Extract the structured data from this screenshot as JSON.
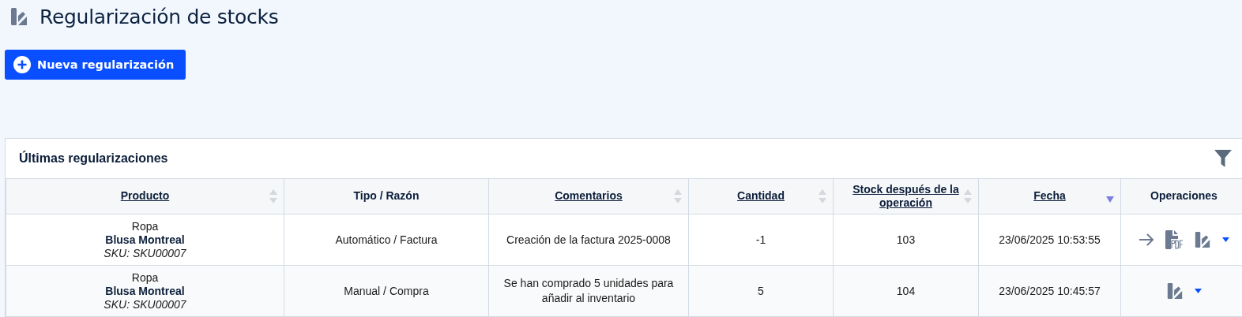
{
  "page": {
    "title": "Regularización de stocks"
  },
  "new_button": {
    "label": "Nueva regularización"
  },
  "panel": {
    "title": "Últimas regularizaciones"
  },
  "table": {
    "columns": [
      {
        "label": "Producto",
        "sortable": true,
        "sorted": false
      },
      {
        "label": "Tipo / Razón",
        "sortable": false
      },
      {
        "label": "Comentarios",
        "sortable": true,
        "sorted": false
      },
      {
        "label": "Cantidad",
        "sortable": true,
        "sorted": false
      },
      {
        "label": "Stock después de la operación",
        "sortable": true,
        "sorted": false
      },
      {
        "label": "Fecha",
        "sortable": true,
        "sorted": true
      },
      {
        "label": "Operaciones",
        "sortable": false
      }
    ],
    "rows": [
      {
        "category": "Ropa",
        "product": "Blusa Montreal",
        "sku": "SKU: SKU00007",
        "type_reason": "Automático / Factura",
        "comment": "Creación de la factura 2025-0008",
        "quantity": "-1",
        "stock_after": "103",
        "date": "23/06/2025 10:53:55",
        "operations": [
          {
            "kind": "arrow"
          },
          {
            "kind": "pdf"
          },
          {
            "kind": "stock"
          },
          {
            "kind": "caret"
          }
        ]
      },
      {
        "category": "Ropa",
        "product": "Blusa Montreal",
        "sku": "SKU: SKU00007",
        "type_reason": "Manual / Compra",
        "comment": "Se han comprado 5 unidades para añadir al inventario",
        "quantity": "5",
        "stock_after": "104",
        "date": "23/06/2025 10:45:57",
        "operations": [
          {
            "kind": "stock"
          },
          {
            "kind": "caret"
          }
        ]
      }
    ]
  }
}
